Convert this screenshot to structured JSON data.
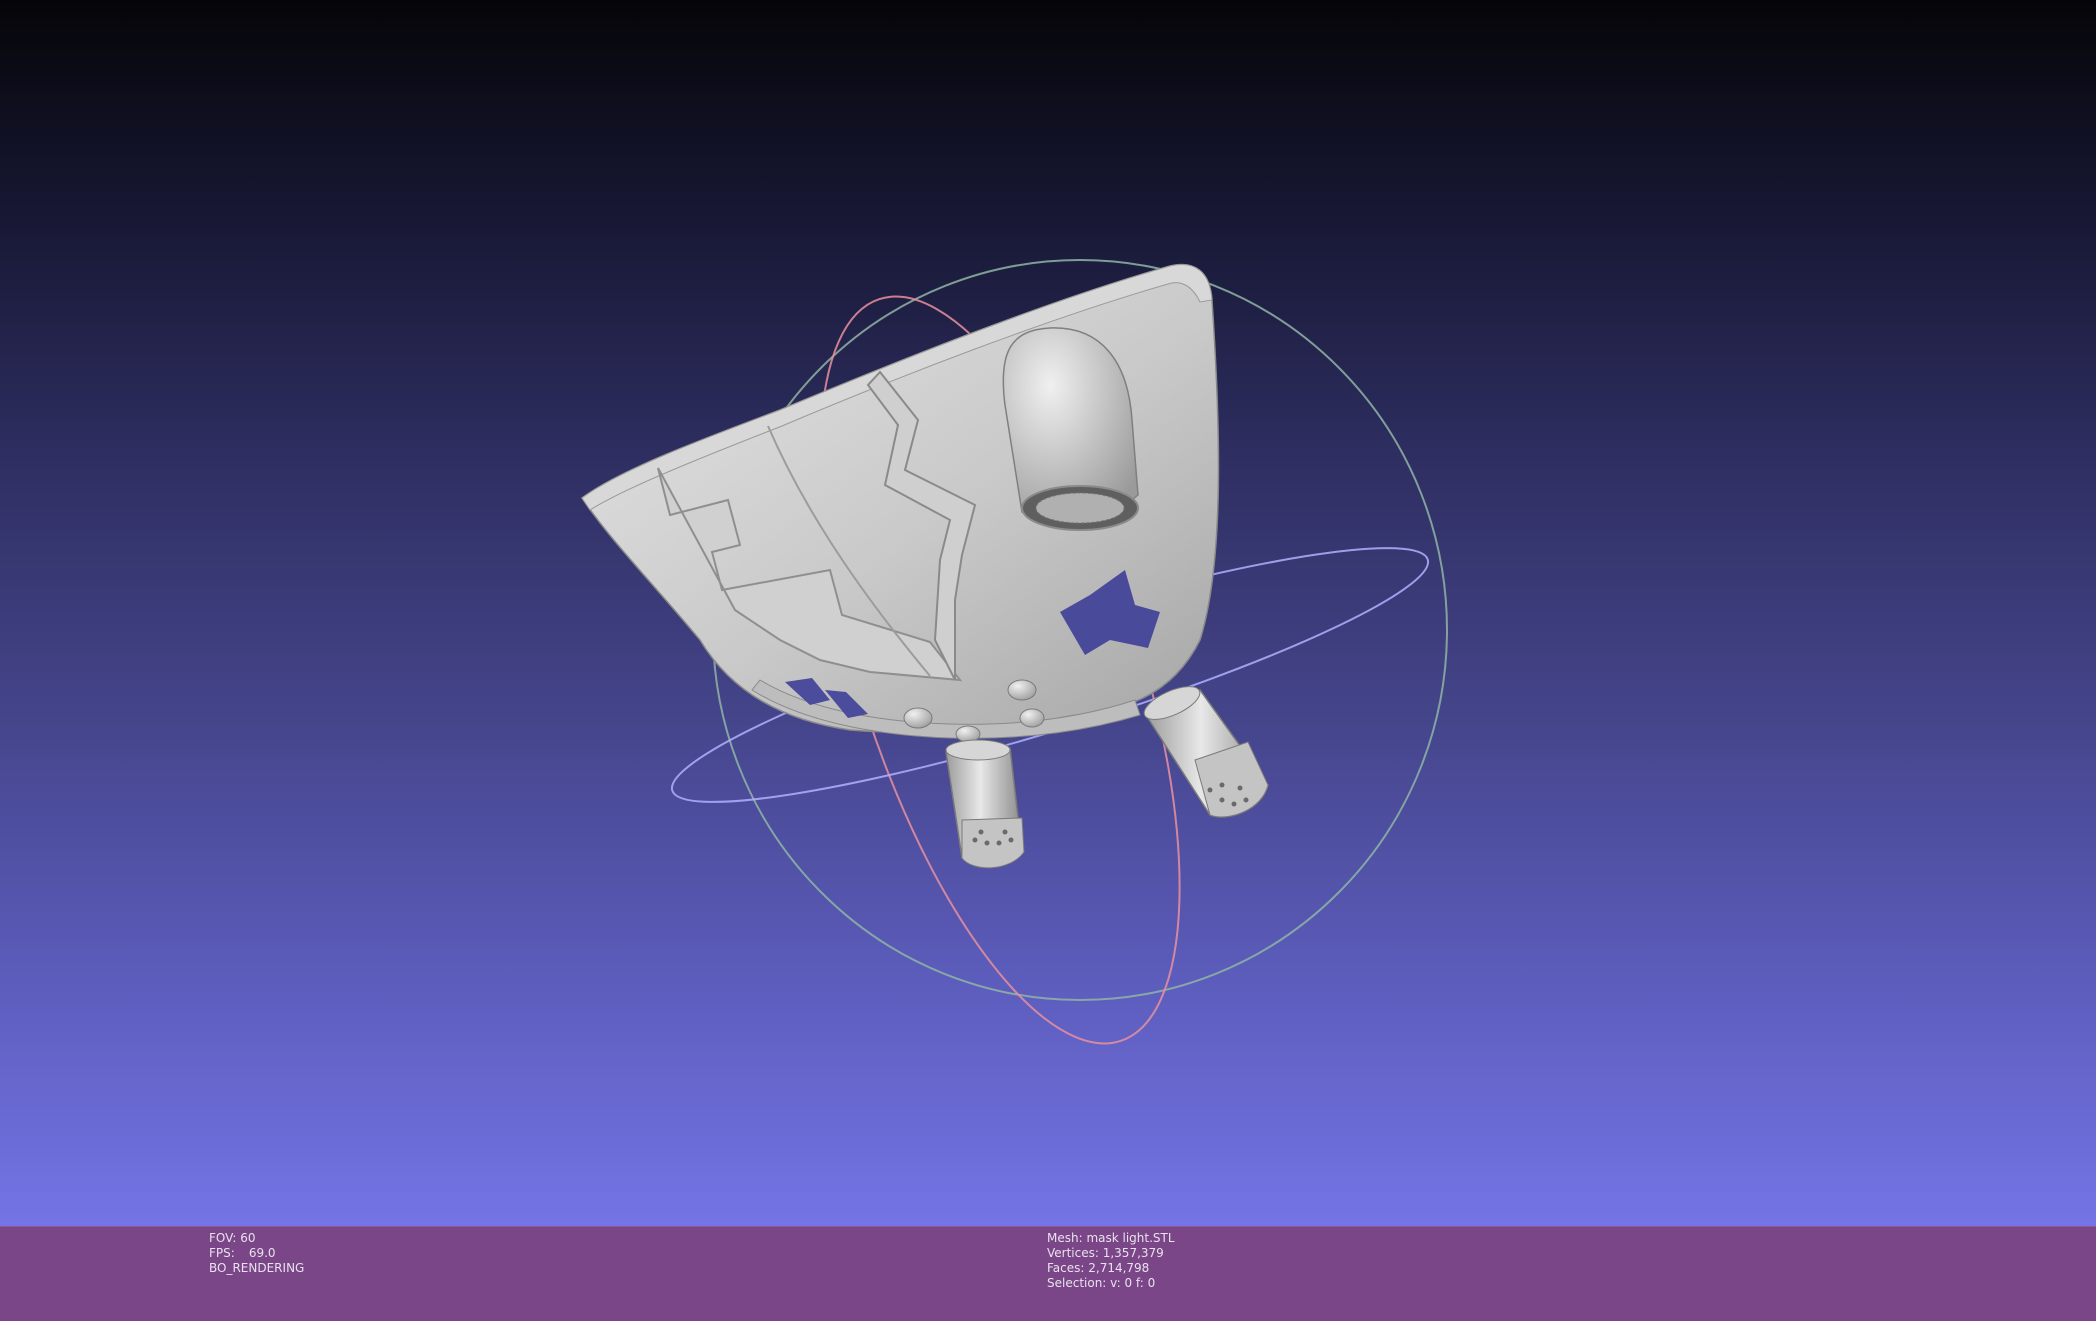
{
  "viewport": {
    "background_top": "#050508",
    "background_bottom": "#7474e6",
    "model": "mask-with-thrusters",
    "trackball_colors": {
      "x_ring": "#e88a9a",
      "y_ring": "#9ad0b0",
      "z_ring": "#a8a8ff"
    }
  },
  "status": {
    "background": "#7b4687",
    "fov": "FOV: 60",
    "fps_label": "FPS:",
    "fps_value": "69.0",
    "render_mode": "BO_RENDERING",
    "mesh": "Mesh: mask light.STL",
    "vertices": "Vertices: 1,357,379",
    "faces": "Faces: 2,714,798",
    "selection": "Selection: v: 0 f: 0"
  }
}
